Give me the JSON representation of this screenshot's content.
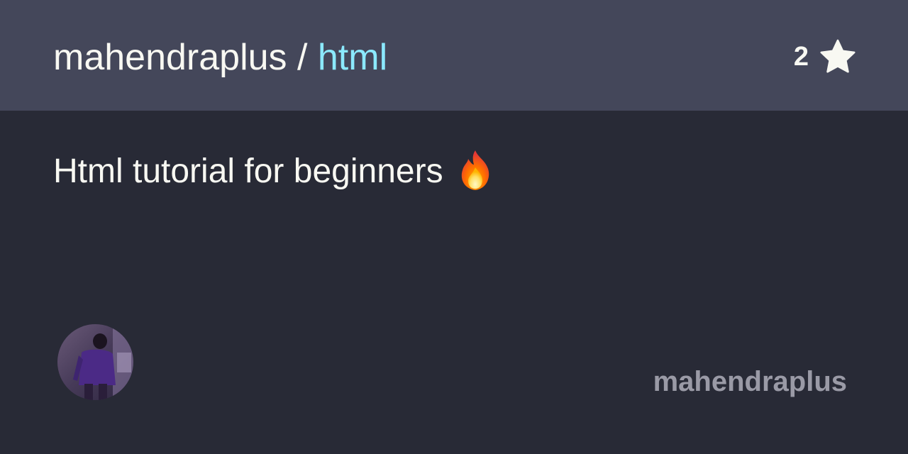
{
  "header": {
    "owner": "mahendraplus",
    "separator": " / ",
    "repo": "html",
    "star_count": "2",
    "star_icon": "star-icon"
  },
  "description": {
    "text": "Html tutorial for beginners ",
    "emoji_icon": "fire-emoji-icon"
  },
  "footer": {
    "avatar_icon": "user-avatar",
    "owner_label": "mahendraplus"
  },
  "colors": {
    "header_bg": "#44475a",
    "body_bg": "#282a36",
    "repo_accent": "#8be9fd",
    "text": "#f8f8f2",
    "owner_label": "#9a9aa6"
  }
}
